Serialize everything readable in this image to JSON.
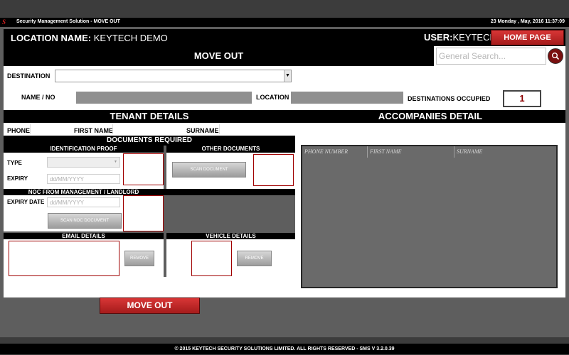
{
  "window": {
    "app_title": "Security Management Solution - MOVE OUT",
    "datetime": "23 Monday , May, 2016 11:37:09",
    "logo_text": "S"
  },
  "header": {
    "location_label": "LOCATION NAME:",
    "location_value": " KEYTECH DEMO",
    "user_label": "USER:",
    "user_value": "KEYTECH",
    "home_button": "HOME PAGE"
  },
  "page": {
    "title": "MOVE OUT",
    "search_placeholder": "General Search...",
    "search_icon": "magnifier-icon"
  },
  "destination": {
    "label": "DESTINATION",
    "value": ""
  },
  "info": {
    "name_label": "NAME / NO",
    "location_label": "LOCATION",
    "occupied_label": "DESTINATIONS OCCUPIED",
    "occupied_value": "1"
  },
  "tenant": {
    "title": "TENANT DETAILS",
    "phone_label": "PHONE",
    "first_name_label": "FIRST NAME",
    "surname_label": "SURNAME"
  },
  "documents": {
    "title": "DOCUMENTS REQUIRED",
    "id_proof_title": "IDENTIFICATION PROOF",
    "other_docs_title": "OTHER DOCUMENTS",
    "type_label": "TYPE",
    "expiry_label": "EXPIRY",
    "expiry_placeholder": "dd/MM/YYYY",
    "scan_document": "SCAN DOCUMENT",
    "noc_title": "NOC FROM MANAGEMENT / LANDLORD",
    "expiry_date_label": "EXPIRY DATE",
    "noc_expiry_placeholder": "dd/MM/YYYY",
    "scan_noc_document": "SCAN NOC DOCUMENT",
    "email_title": "EMAIL DETAILS",
    "vehicle_title": "VEHICLE DETAILS",
    "remove_label": "REMOVE"
  },
  "accompanies": {
    "title": "ACCOMPANIES DETAIL",
    "columns": [
      "PHONE NUMBER",
      "FIRST NAME",
      "SURNAME"
    ]
  },
  "actions": {
    "move_out_button": "MOVE OUT"
  },
  "footer": {
    "text": "© 2015 KEYTECH SECURITY SOLUTIONS LIMITED. ALL RIGHTS RESERVED - SMS V 3.2.0.39"
  },
  "colors": {
    "accent_red": "#a51b1b",
    "header_black": "#000000",
    "panel_grey": "#5e5e5e"
  }
}
